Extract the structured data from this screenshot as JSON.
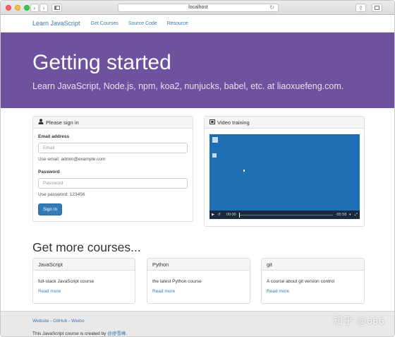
{
  "browser": {
    "url": "localhost",
    "back_icon": "chevron-left-icon",
    "forward_icon": "chevron-right-icon",
    "sidebar_icon": "sidebar-icon",
    "reload_icon": "reload-icon",
    "share_icon": "share-icon",
    "tabs_icon": "tabs-icon"
  },
  "navbar": {
    "brand": "Learn JavaScript",
    "links": [
      "Get Courses",
      "Source Code",
      "Resource"
    ]
  },
  "hero": {
    "title": "Getting started",
    "subtitle": "Learn JavaScript, Node.js, npm, koa2, nunjucks, babel, etc. at liaoxuefeng.com."
  },
  "signin": {
    "heading": "Please sign in",
    "icon": "user-icon",
    "email_label": "Email address",
    "email_placeholder": "Email",
    "email_help": "Use email: admin@example.com",
    "password_label": "Password",
    "password_placeholder": "Password",
    "password_help": "Use password: 123456",
    "submit": "Sign In"
  },
  "video": {
    "heading": "Video training",
    "icon": "film-icon",
    "time_current": "00:00",
    "time_remaining": "-55:58",
    "progress": 0
  },
  "courses": {
    "heading": "Get more courses...",
    "items": [
      {
        "title": "JavaScript",
        "description": "full-stack JavaScript course",
        "link": "Read more"
      },
      {
        "title": "Python",
        "description": "the latest Python course",
        "link": "Read more"
      },
      {
        "title": "git",
        "description": "A course about git version control",
        "link": "Read more"
      }
    ]
  },
  "footer": {
    "links": [
      "Website",
      "GitHub",
      "Weibo"
    ],
    "separator": " - ",
    "credit_prefix": "This JavaScript course is created by ",
    "credit_author": "@廖雪峰",
    "credit_suffix": "."
  },
  "watermark": "知乎 @666",
  "colors": {
    "accent": "#337ab7",
    "hero_bg": "#6e529e",
    "video_bg": "#1f6fb5"
  }
}
